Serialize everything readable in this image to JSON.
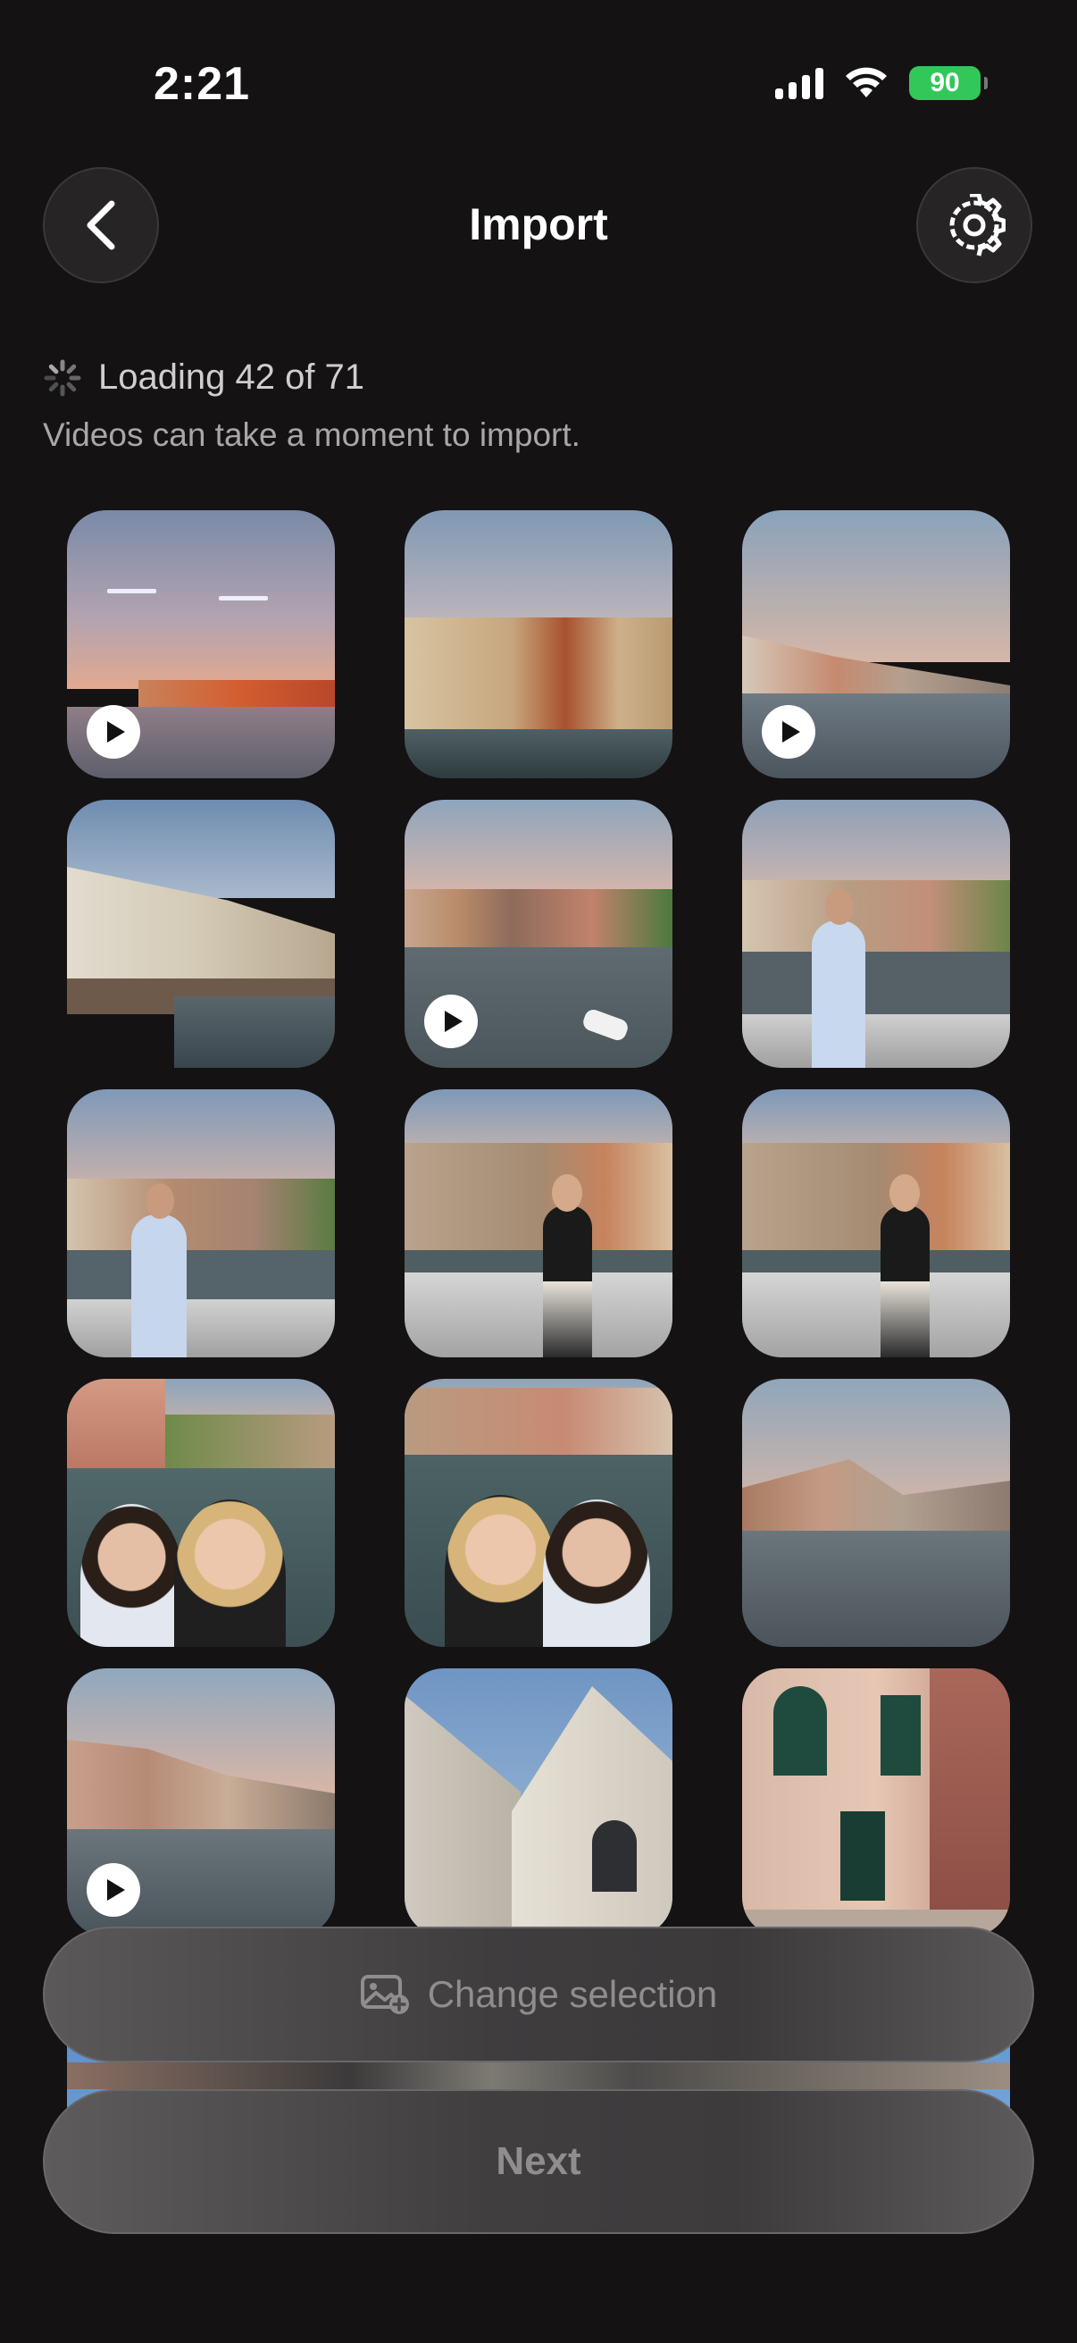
{
  "status_bar": {
    "time": "2:21",
    "battery": "90"
  },
  "header": {
    "title": "Import"
  },
  "loading": {
    "text": "Loading 42 of 71",
    "subtext": "Videos can take a moment to import."
  },
  "grid": {
    "tiles": [
      {
        "kind": "lagoon-sunset",
        "video": true
      },
      {
        "kind": "canal-buildings",
        "video": false
      },
      {
        "kind": "canal-dome",
        "video": true
      },
      {
        "kind": "palazzo-crowd",
        "video": false
      },
      {
        "kind": "canal-boat",
        "video": true
      },
      {
        "kind": "woman-bridge",
        "video": false
      },
      {
        "kind": "woman-bridge-2",
        "video": false
      },
      {
        "kind": "woman-blonde",
        "video": false
      },
      {
        "kind": "woman-blonde-2",
        "video": false
      },
      {
        "kind": "selfie-two",
        "video": false
      },
      {
        "kind": "selfie-two-2",
        "video": false
      },
      {
        "kind": "canal-gondola",
        "video": false
      },
      {
        "kind": "canal-gondola-2",
        "video": true
      },
      {
        "kind": "church",
        "video": false
      },
      {
        "kind": "pink-house",
        "video": false
      },
      {
        "kind": "sky-1",
        "video": false
      },
      {
        "kind": "sky-2",
        "video": false
      },
      {
        "kind": "sky-3",
        "video": false
      }
    ]
  },
  "buttons": {
    "change_selection": "Change selection",
    "next": "Next"
  },
  "colors": {
    "background": "#141213",
    "battery": "#32c759"
  }
}
